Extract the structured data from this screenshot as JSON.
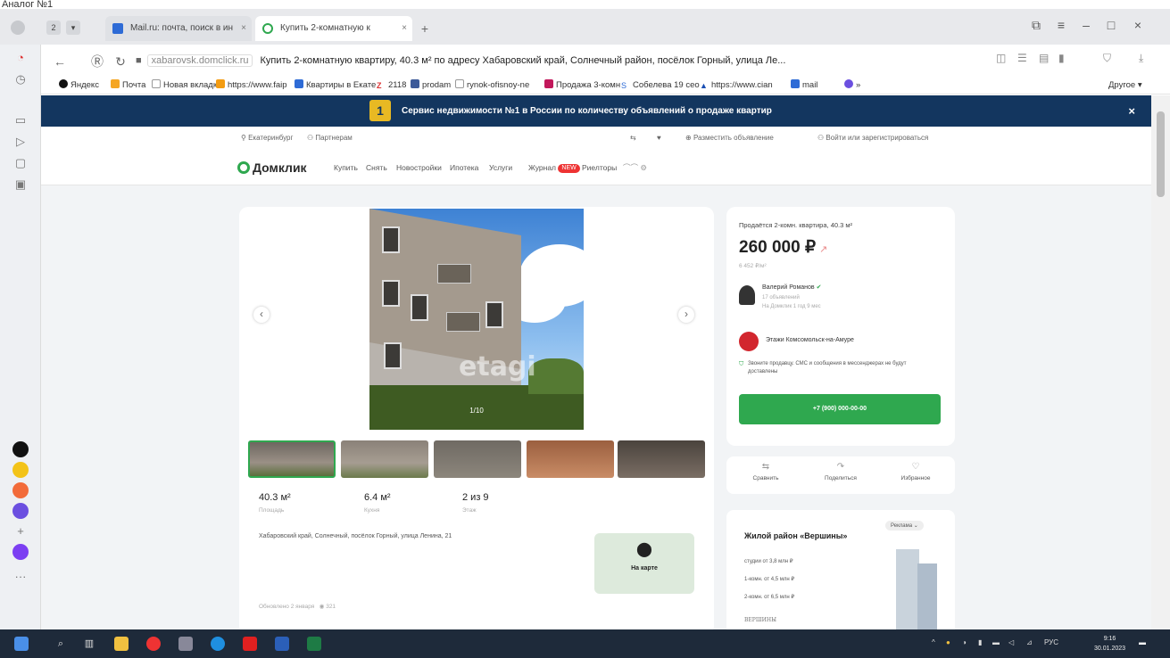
{
  "caption": "Аналог №1",
  "tabs": [
    {
      "label": "Mail.ru: почта, поиск в ин"
    },
    {
      "label": "Купить 2-комнатную к"
    }
  ],
  "address": {
    "domain": "xabarovsk.domclick.ru",
    "title": "Купить 2-комнатную квартиру, 40.3 м² по адресу Хабаровский край, Солнечный район, посёлок Горный, улица Ле..."
  },
  "bookmarks": [
    "Яндекс",
    "Почта",
    "Новая вкладка",
    "https://www.faip",
    "Квартиры в Екате",
    "2118",
    "prodam",
    "rynok-ofisnoy-ne",
    "Продажа 3-комн",
    "Собелева 19 сео",
    "https://www.cian",
    "mail",
    "Другое"
  ],
  "banner": {
    "number": "1",
    "text": "Сервис недвижимости №1 в России по количеству объявлений о продаже квартир"
  },
  "site": {
    "city": "Екатеринбург",
    "partners": "Партнерам",
    "post_ad": "Разместить объявление",
    "login": "Войти или зарегистрироваться",
    "logo": "Домклик",
    "nav": [
      "Купить",
      "Снять",
      "Новостройки",
      "Ипотека",
      "Услуги",
      "Журнал",
      "Риелторы"
    ],
    "nav_badge": "NEW"
  },
  "listing": {
    "photo_counter": "1/10",
    "watermark": "etagi",
    "area_value": "40.3 м²",
    "area_label": "Площадь",
    "kitchen_value": "6.4 м²",
    "kitchen_label": "Кухня",
    "floor_value": "2 из 9",
    "floor_label": "Этаж",
    "address_text": "Хабаровский край, Солнечный, посёлок Горный, улица Ленина, 21",
    "map_label": "На карте",
    "posted": "Обновлено 2 января",
    "views": "321"
  },
  "sidebar_card": {
    "title": "Продаётся 2-комн. квартира, 40.3 м²",
    "price": "260 000 ₽",
    "price_per_m2": "6 452 ₽/м²",
    "agent_name": "Валерий Романов",
    "agent_line1": "17 объявлений",
    "agent_line2": "На Домклик 1 год 9 мес",
    "company": "Этажи Комсомольск-на-Амуре",
    "note": "Звоните продавцу. СМС и сообщения в мессенджерах не будут доставлены",
    "phone": "+7 (900) 000-00-00"
  },
  "actions": [
    {
      "label": "Сравнить"
    },
    {
      "label": "Поделиться"
    },
    {
      "label": "Избранное"
    }
  ],
  "ad": {
    "badge": "Реклама",
    "title": "Жилой район «Вершины»",
    "lines": [
      "студии от 3,8 млн ₽",
      "1-комн. от 4,5 млн ₽",
      "2-комн. от 6,5 млн ₽"
    ],
    "logo": "ВЕРШИНЫ"
  },
  "taskbar": {
    "time": "9:16",
    "date": "30.01.2023",
    "lang": "РУС"
  }
}
